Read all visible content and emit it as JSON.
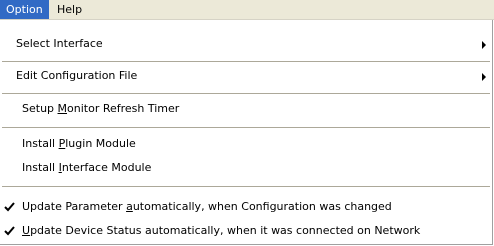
{
  "menubar": {
    "items": [
      {
        "label": "Option",
        "active": true
      },
      {
        "label": "Help",
        "active": false
      }
    ]
  },
  "menu": {
    "select_interface": {
      "label": "Select Interface",
      "has_submenu": true
    },
    "edit_configuration_file": {
      "label": "Edit Configuration File",
      "has_submenu": true
    },
    "setup_monitor_refresh_timer": {
      "pre": "Setup ",
      "mnemonic": "M",
      "post": "onitor Refresh Timer"
    },
    "install_plugin_module": {
      "pre": "Install ",
      "mnemonic": "P",
      "post": "lugin Module"
    },
    "install_interface_module": {
      "pre": "Install ",
      "mnemonic": "I",
      "post": "nterface Module"
    },
    "update_parameter": {
      "pre": "Update Parameter ",
      "mnemonic": "a",
      "post": "utomatically, when Configuration was changed",
      "checked": true
    },
    "update_device_status": {
      "pre": "",
      "mnemonic": "U",
      "post": "pdate Device Status automatically, when it was connected on Network",
      "checked": true
    }
  },
  "colors": {
    "highlight": "#316ac5",
    "menubar_bg": "#ece9d8"
  },
  "icons": {
    "submenu": "chevron-right-icon",
    "check": "checkmark-icon"
  }
}
